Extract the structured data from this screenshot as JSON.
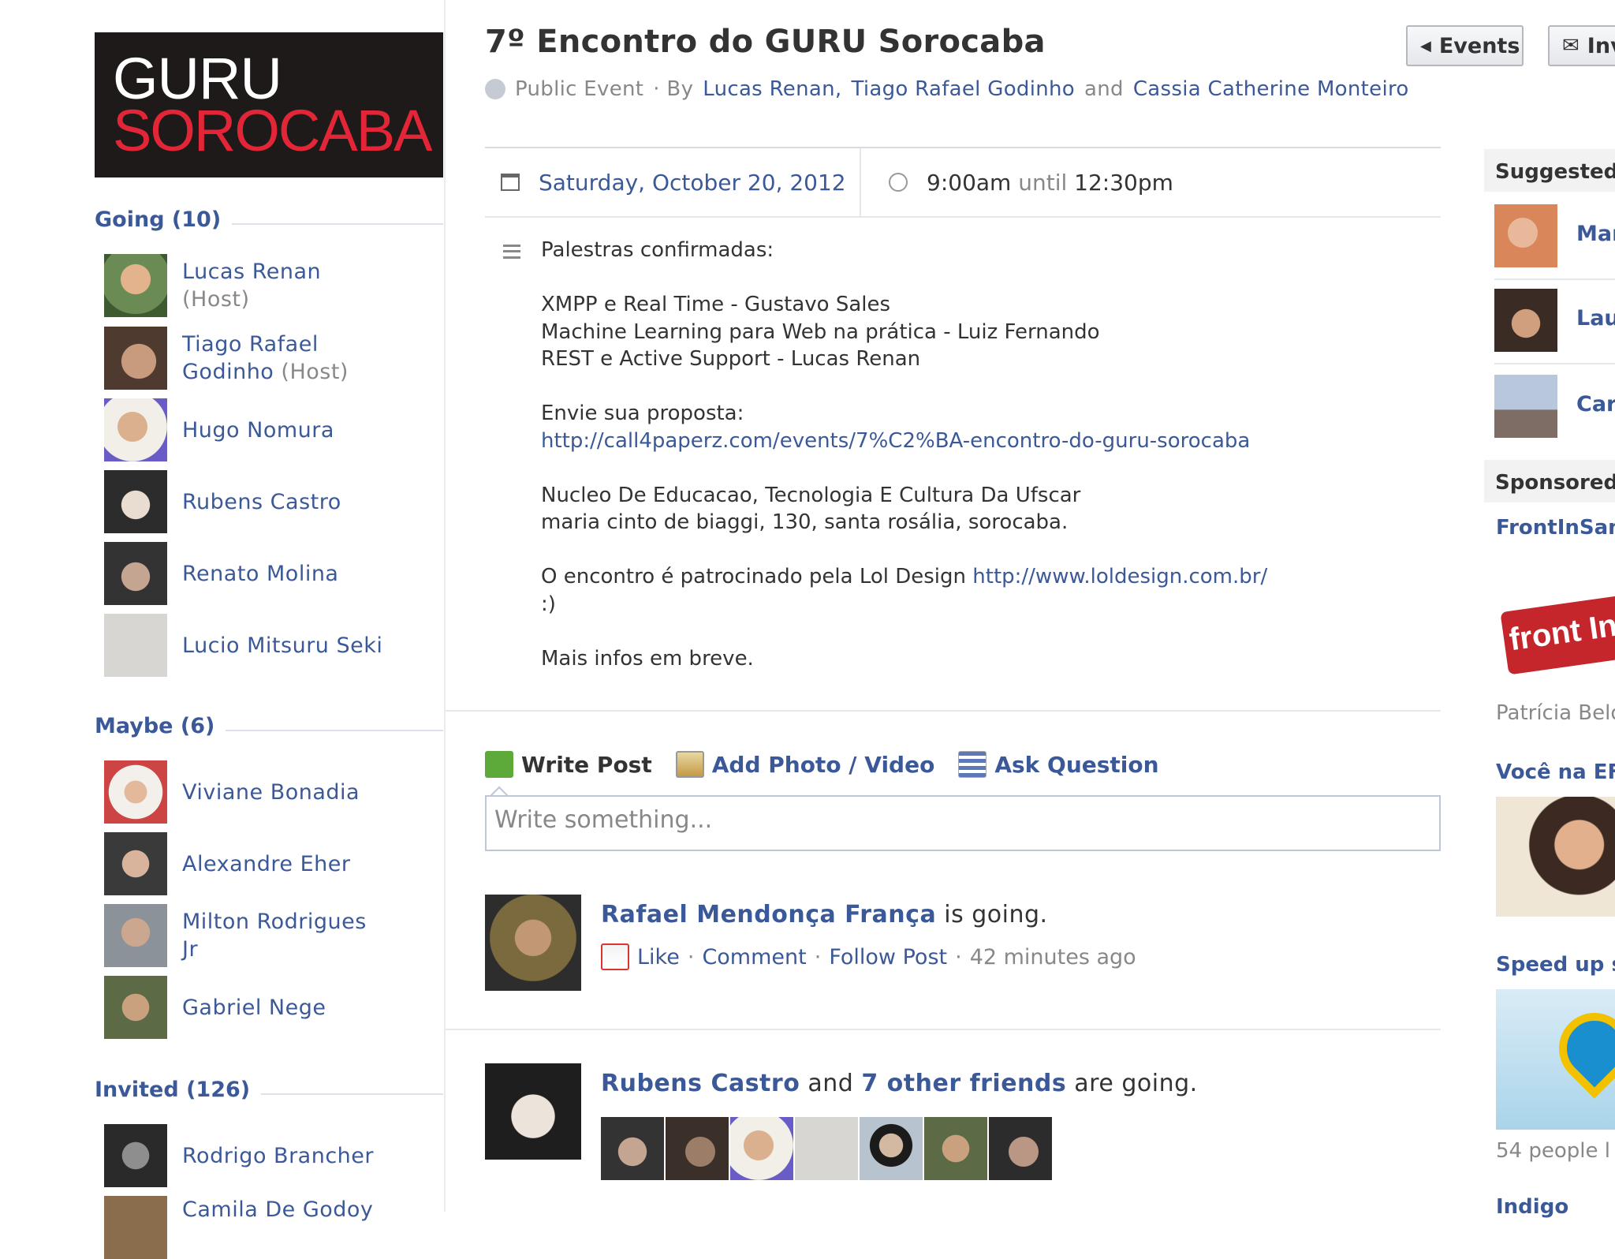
{
  "logo": {
    "line1": "GURU",
    "line2": "SOROCABA"
  },
  "sections": {
    "going": "Going (10)",
    "maybe": "Maybe (6)",
    "invited": "Invited (126)"
  },
  "going_people": [
    {
      "name": "Lucas Renan",
      "role": "(Host)"
    },
    {
      "name": "Tiago Rafael Godinho",
      "role": "(Host)"
    },
    {
      "name": "Hugo Nomura",
      "role": ""
    },
    {
      "name": "Rubens Castro",
      "role": ""
    },
    {
      "name": "Renato Molina",
      "role": ""
    },
    {
      "name": "Lucio Mitsuru Seki",
      "role": ""
    }
  ],
  "maybe_people": [
    {
      "name": "Viviane Bonadia"
    },
    {
      "name": "Alexandre Eher"
    },
    {
      "name": "Milton Rodrigues Jr"
    },
    {
      "name": "Gabriel Nege"
    }
  ],
  "invited_people": [
    {
      "name": "Rodrigo Brancher"
    },
    {
      "name": "Camila De Godoy"
    }
  ],
  "event": {
    "title": "7º Encontro do GURU Sorocaba",
    "visibility": "Public Event",
    "by_prefix": "· By",
    "host1": "Lucas Renan,",
    "host2": "Tiago Rafael Godinho",
    "and": "and",
    "host3": "Cassia Catherine Monteiro",
    "date": "Saturday, October 20, 2012",
    "time_start": "9:00am",
    "time_until": "until",
    "time_end": "12:30pm"
  },
  "buttons": {
    "events": "Events",
    "invite": "Invite"
  },
  "description": {
    "heading": "Palestras confirmadas:",
    "talks": [
      "XMPP e Real Time - Gustavo Sales",
      "Machine Learning para Web na prática - Luiz Fernando",
      "REST e Active Support - Lucas Renan"
    ],
    "proposal_label": "Envie sua proposta:",
    "proposal_link": "http://call4paperz.com/events/7%C2%BA-encontro-do-guru-sorocaba",
    "venue1": "Nucleo De Educacao, Tecnologia E Cultura Da Ufscar",
    "venue2": "maria cinto de biaggi, 130, santa rosália, sorocaba.",
    "sponsor_text": "O encontro é patrocinado pela Lol Design",
    "sponsor_link": "http://www.loldesign.com.br/",
    "smiley": ":)",
    "more": "Mais infos em breve."
  },
  "composer": {
    "write_post": "Write Post",
    "add_photo": "Add Photo / Video",
    "ask_question": "Ask Question",
    "placeholder": "Write something..."
  },
  "stories": [
    {
      "actor": "Rafael Mendonça França",
      "text": "is going.",
      "like": "Like",
      "comment": "Comment",
      "follow": "Follow Post",
      "time": "42 minutes ago"
    },
    {
      "actor": "Rubens Castro",
      "and": "and",
      "others": "7 other friends",
      "text": "are going."
    }
  ],
  "right": {
    "suggested_head": "Suggested",
    "suggested": [
      "Mar",
      "Lau",
      "Car"
    ],
    "sponsored_head": "Sponsored",
    "ad1_title": "FrontInSam",
    "ad1_image_text": "front In <sam",
    "ad1_meta": "Patrícia Belo",
    "ad2_title": "Você na EF",
    "ad3_title": "Speed up s",
    "ad3_meta": "54 people l",
    "ad4_title": "Indigo"
  }
}
